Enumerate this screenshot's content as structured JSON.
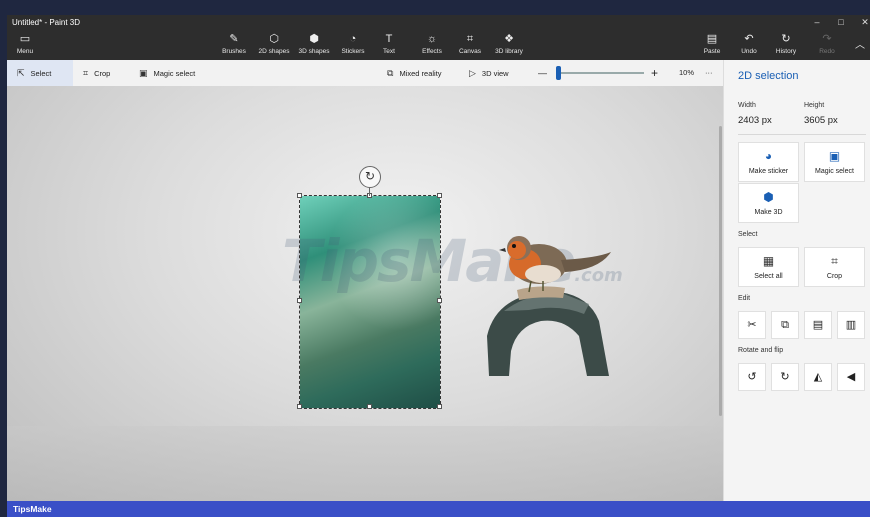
{
  "window": {
    "title": "Untitled* - Paint 3D",
    "min_glyph": "–",
    "max_glyph": "□",
    "close_glyph": "✕"
  },
  "ribbon": {
    "menu": "Menu",
    "brushes": "Brushes",
    "shapes2d": "2D shapes",
    "shapes3d": "3D shapes",
    "stickers": "Stickers",
    "text": "Text",
    "effects": "Effects",
    "canvas": "Canvas",
    "library3d": "3D library",
    "paste": "Paste",
    "undo": "Undo",
    "history": "History",
    "redo": "Redo",
    "collapse_glyph": "︿"
  },
  "toolbar": {
    "select": "Select",
    "crop": "Crop",
    "magic_select": "Magic select",
    "mixed_reality": "Mixed reality",
    "view3d": "3D view",
    "zoom_minus": "—",
    "zoom_plus": "+",
    "zoom_value": 0.1,
    "zoom_label": "10%",
    "more": "···"
  },
  "canvas": {
    "watermark_main": "TipsMake",
    "watermark_suffix": ".com"
  },
  "panel": {
    "title": "2D selection",
    "width_label": "Width",
    "height_label": "Height",
    "width_value": "2403 px",
    "height_value": "3605 px",
    "make_sticker": "Make sticker",
    "magic_select": "Magic select",
    "make_3d": "Make 3D",
    "select_section": "Select",
    "select_all": "Select all",
    "crop": "Crop",
    "edit_section": "Edit",
    "rotate_section": "Rotate and flip"
  },
  "status": {
    "brand": "TipsMake"
  },
  "colors": {
    "accent": "#1a5fb4",
    "status_bar": "#3a4fc7",
    "ribbon": "#2d2d2d"
  }
}
